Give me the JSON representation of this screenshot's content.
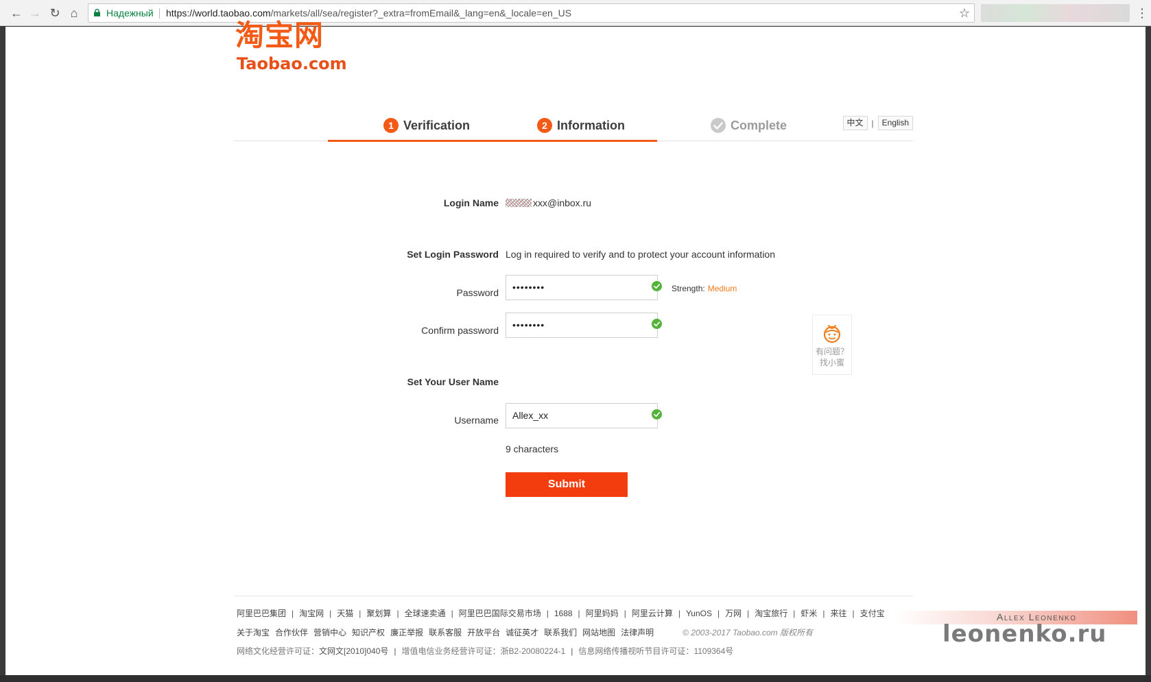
{
  "browser": {
    "secure_label": "Надежный",
    "url_host": "https://world.taobao.com",
    "url_path": "/markets/all/sea/register?_extra=fromEmail&_lang=en&_locale=en_US"
  },
  "logo": {
    "cn": "淘宝网",
    "en": "Taobao.com"
  },
  "steps": [
    {
      "num": "1",
      "label": "Verification"
    },
    {
      "num": "2",
      "label": "Information"
    },
    {
      "label": "Complete"
    }
  ],
  "lang": {
    "cn": "中文",
    "sep": "|",
    "en": "English"
  },
  "form": {
    "login_name_label": "Login Name",
    "login_name_value": "xxx@inbox.ru",
    "set_password_label": "Set Login Password",
    "set_password_note": "Log in required to verify and to protect your account information",
    "password_label": "Password",
    "password_value": "••••••••",
    "strength_label": "Strength:",
    "strength_value": "Medium",
    "confirm_label": "Confirm password",
    "confirm_value": "••••••••",
    "set_username_label": "Set Your User Name",
    "username_label": "Username",
    "username_value": "Allex_xx",
    "char_count": "9 characters",
    "submit_label": "Submit"
  },
  "help": {
    "line1": "有问题？",
    "line2": "找小蜜"
  },
  "footer": {
    "row1": [
      "阿里巴巴集团",
      "淘宝网",
      "天猫",
      "聚划算",
      "全球速卖通",
      "阿里巴巴国际交易市场",
      "1688",
      "阿里妈妈",
      "阿里云计算",
      "YunOS",
      "万网",
      "淘宝旅行",
      "虾米",
      "来往",
      "支付宝"
    ],
    "row2": [
      "关于淘宝",
      "合作伙伴",
      "营销中心",
      "知识产权",
      "廉正举报",
      "联系客服",
      "开放平台",
      "诚征英才",
      "联系我们",
      "网站地图",
      "法律声明"
    ],
    "copyright": "© 2003-2017 Taobao.com 版权所有",
    "row3_a_label": "网络文化经营许可证：",
    "row3_a_value": "文网文[2010]040号",
    "row3_b_label": "增值电信业务经营许可证：",
    "row3_b_value": "浙B2-20080224-1",
    "row3_c_label": "信息网络传播视听节目许可证：",
    "row3_c_value": "1109364号"
  },
  "watermark": {
    "name": "Allex Leonenko",
    "site": "leonenko.ru"
  },
  "colors": {
    "brand": "#f25a15",
    "submit": "#f33d0e",
    "ok": "#53b33a",
    "strength": "#f27b1c"
  }
}
